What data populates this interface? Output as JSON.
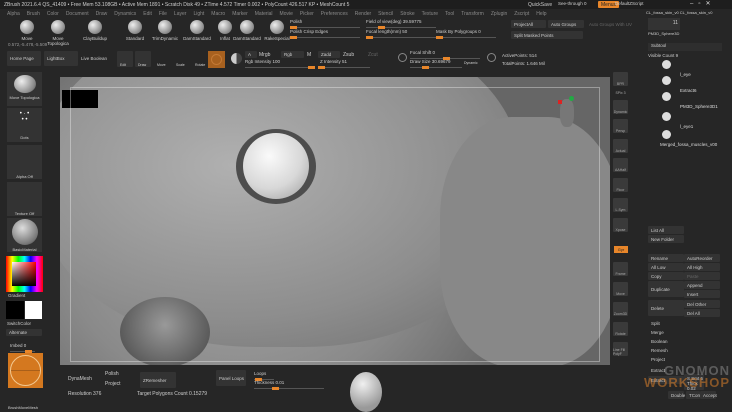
{
  "titlebar": {
    "text": "ZBrush 2021.6.4   QS_41409  • Free Mem 53.108GB • Active Mem 1891 • Scratch Disk 49 • ZTime 4.572 Timer 0.002 • PolyCount 426.517 KP • MeshCount 5",
    "quicksave": "QuickSave",
    "see_through": "See-through 0",
    "menus": "Menus",
    "default_script": "DefaultZScript"
  },
  "menu": [
    "Alpha",
    "Brush",
    "Color",
    "Document",
    "Draw",
    "Dynamics",
    "Edit",
    "File",
    "Layer",
    "Light",
    "Macro",
    "Marker",
    "Material",
    "Movie",
    "Picker",
    "Preferences",
    "Render",
    "Stencil",
    "Stroke",
    "Texture",
    "Tool",
    "Transform",
    "Zplugin",
    "Zscript",
    "Help"
  ],
  "brushes": [
    "Move",
    "Move Topologica",
    "ClayBuildup",
    "Standard",
    "TrimDynamic",
    "DamStandard",
    "Inflat",
    "DamStandard",
    "RakeSpecial"
  ],
  "coords": "0.572,-5.478,-5.509",
  "top_controls": {
    "polish": "Polish",
    "polish_crisp": "Polish Crisp Edges",
    "fov": "Field of view(deg) 39.59775",
    "focal": "Focal length(mm) 50",
    "mask_poly": "Mask By Polygroups 0",
    "project_all": "ProjectAll",
    "auto_groups": "Auto Groups",
    "auto_groups_uv": "Auto Groups With UV",
    "split_masked": "Split Masked Points"
  },
  "toolbar": {
    "home": "Home Page",
    "lightbox": "LightBox",
    "live_boolean": "Live Boolean",
    "edit": "Edit",
    "draw": "Draw",
    "move": "Move",
    "scale": "Scale",
    "rotate": "Rotate",
    "a": "A",
    "mrgb": "Mrgb",
    "rgb": "Rgb",
    "m": "M",
    "zadd": "Zadd",
    "zsub": "Zsub",
    "zcut": "Zcut",
    "rgb_intensity": "Rgb Intensity 100",
    "z_intensity": "Z Intensity 51",
    "focal_shift": "Focal Shift 0",
    "draw_size": "Draw Size 30.69679",
    "dynamic": "Dynamic",
    "active_points": "ActivePoints: 514",
    "total_points": "TotalPoints: 1.646 Mil"
  },
  "left": {
    "brush": "Move Topologica",
    "stroke": "Dots",
    "alpha": "Alpha Off",
    "texture": "Texture Off",
    "material": "BasicMaterial",
    "gradient": "Gradient",
    "switch": "SwitchColor",
    "alternate": "Alternate",
    "imbed": "Imbed 0",
    "bottom": "BrushMoveMesh"
  },
  "right_tools": [
    "BPR",
    "SPix 3",
    "Dynamic",
    "Persp",
    "Actual",
    "AAHalf",
    "Floor",
    "L.Sym",
    "Xpose",
    "Frame",
    "Move",
    "Zoom3D",
    "Rotate",
    "Line Fill PolyF"
  ],
  "subtool": {
    "header_tools": "CL_fossa_skin_v0  CL_fossa_skin_v0",
    "count": "11",
    "sphere_name": "PM3D_Sphere3D",
    "title": "Subtool",
    "visible_count": "Visible Count 9",
    "items": [
      "l_eye",
      "Extract6",
      "PM3D_Sphere3D1",
      "l_eye1",
      "Merged_fossa_muscles_v00"
    ]
  },
  "subtool_buttons": [
    "List All",
    "New Folder",
    "Rename",
    "AutoReorder",
    "All Low",
    "All High",
    "Copy",
    "Paste",
    "Duplicate",
    "Append",
    "Insert",
    "Delete",
    "Del Other",
    "Del All",
    "Split",
    "Merge",
    "Boolean",
    "Remesh",
    "Project",
    "Extract",
    "Extract",
    "S Smt 5",
    "Thick 0.02",
    "Double",
    "TCorne",
    "Accept"
  ],
  "bottom": {
    "dynamesh": "DynaMesh",
    "polish": "Polish",
    "project": "Project",
    "resolution": "Resolution 376",
    "zremesher": "ZRemesher",
    "target": "Target Polygons Count 0.15279",
    "panel_loops": "Panel Loops",
    "loops": "Loops",
    "thickness": "Thickness 0.01"
  },
  "watermark": "THE GNOMON WORKSHOP",
  "colors": {
    "accent": "#e8862a",
    "bg": "#262626"
  }
}
